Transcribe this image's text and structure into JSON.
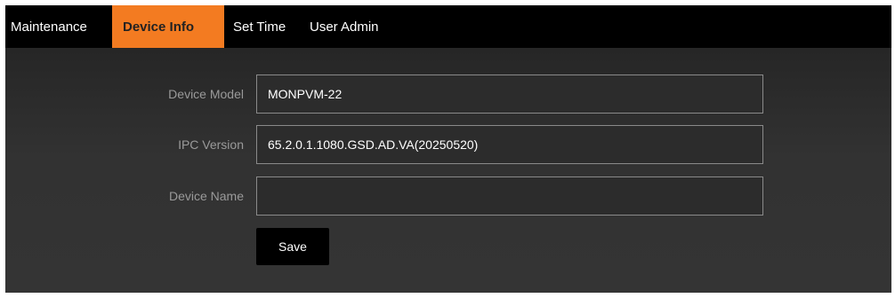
{
  "tabs": [
    {
      "label": "Maintenance",
      "active": false
    },
    {
      "label": "Device Info",
      "active": true
    },
    {
      "label": "Set Time",
      "active": false
    },
    {
      "label": "User Admin",
      "active": false
    }
  ],
  "form": {
    "device_model": {
      "label": "Device Model",
      "value": "MONPVM-22"
    },
    "ipc_version": {
      "label": "IPC Version",
      "value": "65.2.0.1.1080.GSD.AD.VA(20250520)"
    },
    "device_name": {
      "label": "Device Name",
      "value": ""
    },
    "save_label": "Save"
  },
  "colors": {
    "active_tab": "#f37b21",
    "tab_bar": "#000000",
    "panel": "#2b2b2b"
  }
}
